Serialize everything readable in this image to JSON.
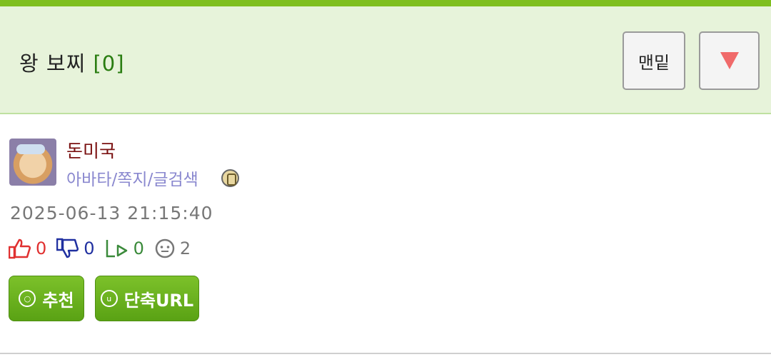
{
  "header": {
    "title": "왕 보찌",
    "comment_count": "[0]",
    "bottom_button": "맨밑",
    "down_arrow": "triangle-down-icon"
  },
  "author": {
    "nickname": "돈미국",
    "links": [
      "아바타",
      "쪽지",
      "글검색"
    ],
    "link_separator": "/"
  },
  "post": {
    "datetime": "2025-06-13 21:15:40"
  },
  "stats": {
    "likes": "0",
    "dislikes": "0",
    "shares": "0",
    "views": "2"
  },
  "actions": {
    "recommend_label": "추천",
    "recommend_icon_glyph": "○",
    "short_url_label": "단축URL",
    "short_url_icon_glyph": "u"
  },
  "colors": {
    "accent_green": "#7fbf1f",
    "header_bg": "#e7f3da",
    "nickname": "#7a1010",
    "link_purple": "#8a88cf"
  }
}
